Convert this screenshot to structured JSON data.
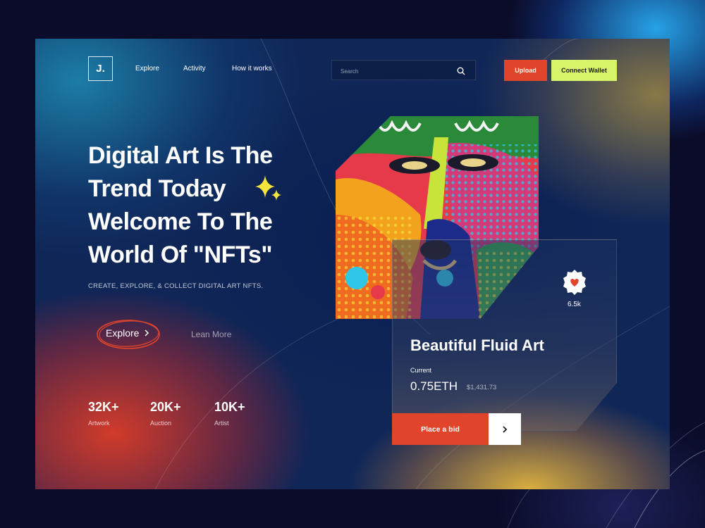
{
  "brand": {
    "logo_text": "J."
  },
  "nav": {
    "items": [
      "Explore",
      "Activity",
      "How it works"
    ]
  },
  "search": {
    "placeholder": "Search"
  },
  "actions": {
    "upload": "Upload",
    "connect_wallet": "Connect Wallet"
  },
  "hero": {
    "title_lines": [
      "Digital Art Is The",
      "Trend Today",
      "Welcome To The",
      "World Of \"NFTs\""
    ],
    "subtitle": "CREATE, EXPLORE, & COLLECT DIGITAL ART NFTS.",
    "explore_label": "Explore",
    "learn_more_label": "Lean More"
  },
  "stats": [
    {
      "value": "32K+",
      "label": "Artwork"
    },
    {
      "value": "20K+",
      "label": "Auction"
    },
    {
      "value": "10K+",
      "label": "Artist"
    }
  ],
  "nft_card": {
    "likes": "6.5k",
    "title": "Beautiful Fluid Art",
    "current_label": "Current",
    "price_eth": "0.75ETH",
    "price_usd": "$1,431.73",
    "bid_label": "Place a bid"
  },
  "colors": {
    "accent_red": "#e0452b",
    "accent_lime": "#d8f46a",
    "sparkle_yellow": "#f4e43c"
  },
  "icons": {
    "search": "search-icon",
    "chevron": "chevron-right-icon",
    "heart": "heart-icon",
    "sparkle": "sparkle-icon"
  }
}
